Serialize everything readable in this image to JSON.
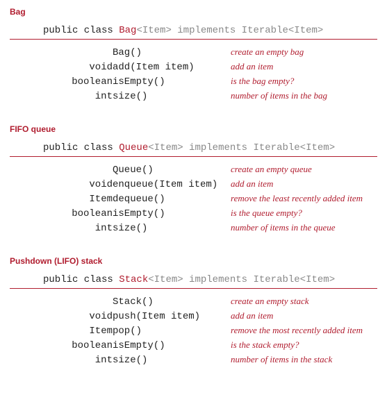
{
  "sections": [
    {
      "title": "Bag",
      "decl": {
        "prefix": "public class ",
        "name": "Bag",
        "generic": "<Item>",
        "suffix": " implements Iterable<Item>"
      },
      "rows": [
        {
          "ret": "",
          "sig": "Bag()",
          "desc": "create an empty bag"
        },
        {
          "ret": "void",
          "sig": "add(Item item)",
          "desc": "add an item"
        },
        {
          "ret": "boolean",
          "sig": "isEmpty()",
          "desc": "is the bag empty?"
        },
        {
          "ret": "int",
          "sig": "size()",
          "desc": "number of items in the bag"
        }
      ]
    },
    {
      "title": "FIFO queue",
      "decl": {
        "prefix": "public class ",
        "name": "Queue",
        "generic": "<Item>",
        "suffix": " implements Iterable<Item>"
      },
      "rows": [
        {
          "ret": "",
          "sig": "Queue()",
          "desc": "create an empty queue"
        },
        {
          "ret": "void",
          "sig": "enqueue(Item item)",
          "desc": "add an item"
        },
        {
          "ret": "Item",
          "sig": "dequeue()",
          "desc": "remove the least recently added item"
        },
        {
          "ret": "boolean",
          "sig": "isEmpty()",
          "desc": "is the queue empty?"
        },
        {
          "ret": "int",
          "sig": "size()",
          "desc": "number of items in the queue"
        }
      ]
    },
    {
      "title": "Pushdown (LIFO) stack",
      "decl": {
        "prefix": "public class ",
        "name": "Stack",
        "generic": "<Item>",
        "suffix": " implements Iterable<Item>"
      },
      "rows": [
        {
          "ret": "",
          "sig": "Stack()",
          "desc": "create an empty stack"
        },
        {
          "ret": "void",
          "sig": "push(Item item)",
          "desc": "add an item"
        },
        {
          "ret": "Item",
          "sig": "pop()",
          "desc": "remove the most recently added item"
        },
        {
          "ret": "boolean",
          "sig": "isEmpty()",
          "desc": "is the stack empty?"
        },
        {
          "ret": "int",
          "sig": "size()",
          "desc": "number of items in the stack"
        }
      ]
    }
  ]
}
